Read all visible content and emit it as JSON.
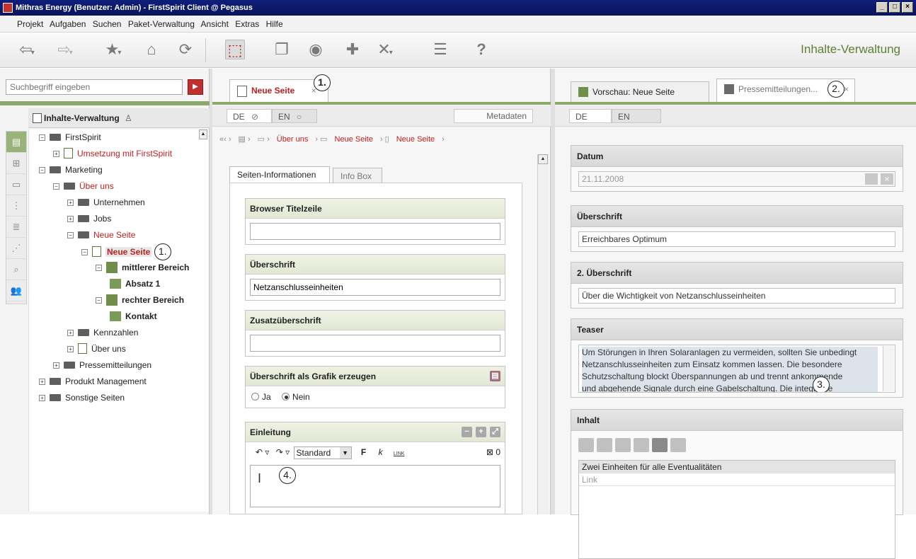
{
  "window": {
    "title": "Mithras Energy (Benutzer: Admin) - FirstSpirit Client @ Pegasus",
    "buttons": [
      "_",
      "□",
      "×"
    ]
  },
  "menu": [
    "Projekt",
    "Aufgaben",
    "Suchen",
    "Paket-Verwaltung",
    "Ansicht",
    "Extras",
    "Hilfe"
  ],
  "toolbar": {
    "app_name": "Inhalte-Verwaltung",
    "icons": [
      "back-icon",
      "forward-icon",
      "star-icon",
      "home-icon",
      "refresh-icon",
      "select-page-icon",
      "page-copy-icon",
      "preview-icon",
      "add-page-icon",
      "delete-page-icon",
      "checklist-icon",
      "help-icon"
    ],
    "accent": "#5f7f32"
  },
  "left": {
    "search_placeholder": "Suchbegriff eingeben",
    "header": "Inhalte-Verwaltung",
    "tree": [
      {
        "label": "FirstSpirit"
      },
      {
        "label": "Umsetzung mit FirstSpirit"
      },
      {
        "label": "Marketing"
      },
      {
        "label": "Über uns"
      },
      {
        "label": "Unternehmen"
      },
      {
        "label": "Jobs"
      },
      {
        "label": "Neue Seite"
      },
      {
        "label": "Neue Seite"
      },
      {
        "label": "mittlerer Bereich"
      },
      {
        "label": "Absatz 1"
      },
      {
        "label": "rechter Bereich"
      },
      {
        "label": "Kontakt"
      },
      {
        "label": "Kennzahlen"
      },
      {
        "label": "Über uns"
      },
      {
        "label": "Pressemitteilungen"
      },
      {
        "label": "Produkt Management"
      },
      {
        "label": "Sonstige Seiten"
      }
    ],
    "marker": "1."
  },
  "middle": {
    "tab": "Neue Seite",
    "tab_marker": "1.",
    "langs": [
      "DE",
      "EN"
    ],
    "metadata": "Metadaten",
    "breadcrumbs": [
      "Über uns",
      "Neue Seite",
      "Neue Seite"
    ],
    "inner_tabs": [
      "Seiten-Informationen",
      "Info Box"
    ],
    "fields": {
      "browser_title": {
        "label": "Browser Titelzeile",
        "value": ""
      },
      "headline": {
        "label": "Überschrift",
        "value": "Netzanschlusseinheiten"
      },
      "sub_headline": {
        "label": "Zusatzüberschrift",
        "value": ""
      },
      "graphic": {
        "label": "Überschrift als Grafik erzeugen",
        "opt_yes": "Ja",
        "opt_no": "Nein"
      },
      "intro": {
        "label": "Einleitung",
        "style": "Standard",
        "bold": "F",
        "italic": "k",
        "link": "LINK",
        "count": "0",
        "marker": "4."
      }
    }
  },
  "right": {
    "tabs": [
      "Vorschau: Neue Seite",
      "Pressemitteilungen..."
    ],
    "tab_marker": "2.",
    "langs": [
      "DE",
      "EN"
    ],
    "date": {
      "label": "Datum",
      "value": "21.11.2008"
    },
    "headline": {
      "label": "Überschrift",
      "value": "Erreichbares Optimum"
    },
    "headline2": {
      "label": "2. Überschrift",
      "value": "Über die Wichtigkeit von Netzanschlusseinheiten"
    },
    "teaser": {
      "label": "Teaser",
      "lines": [
        "Um Störungen in Ihren Solaranlagen zu vermeiden, sollten Sie unbedingt",
        "Netzanschlusseinheiten zum Einsatz kommen lassen. Die besondere",
        "Schutzschaltung blockt Überspannungen ab und trennt ankommende",
        "und abgehende Signale durch eine Gabelschaltung. Die integrierte"
      ],
      "marker": "3."
    },
    "content": {
      "label": "Inhalt",
      "row_header": "Zwei Einheiten für alle Eventualitäten",
      "row_link": "Link"
    }
  }
}
